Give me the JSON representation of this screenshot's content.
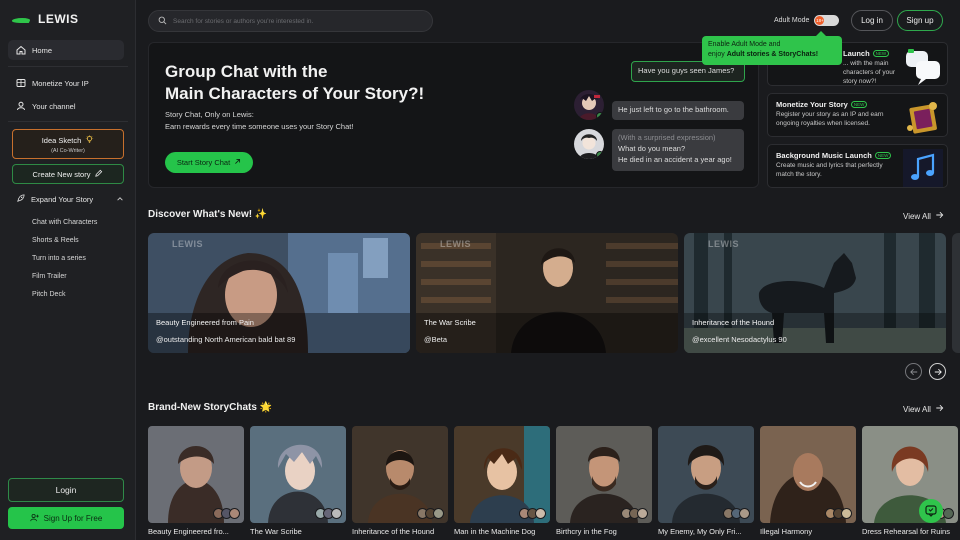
{
  "brand": {
    "name": "LEWIS"
  },
  "sidebar": {
    "items": [
      {
        "label": "Home",
        "icon": "home-icon"
      },
      {
        "label": "Monetize Your IP",
        "icon": "monetize-icon"
      },
      {
        "label": "Your channel",
        "icon": "user-icon"
      }
    ],
    "idea_sketch": {
      "label": "Idea Sketch",
      "sub": "(AI Co-Writer)"
    },
    "create_story": "Create New story",
    "expand": {
      "label": "Expand Your Story",
      "children": [
        "Chat with Characters",
        "Shorts & Reels",
        "Turn into a series",
        "Film Trailer",
        "Pitch Deck"
      ]
    },
    "login": "Login",
    "signup": "Sign Up for Free"
  },
  "topbar": {
    "search_placeholder": "Search for stories or authors you're interested in.",
    "adult_mode": "Adult Mode",
    "adult_badge": "18+",
    "login": "Log in",
    "signup": "Sign up",
    "tooltip": {
      "line1": "Enable Adult Mode and",
      "line2_prefix": "enjoy ",
      "line2_bold": "Adult stories & StoryChats!"
    }
  },
  "hero": {
    "title_line1": "Group Chat with the",
    "title_line2": "Main Characters of Your Story?!",
    "sub1": "Story Chat, Only on Lewis:",
    "sub2": "Earn rewards every time someone uses your Story Chat!",
    "cta": "Start Story Chat",
    "chat": {
      "q": "Have you guys seen James?",
      "a": "He just left to go to the bathroom.",
      "b_em": "(With a surprised expression)",
      "b_1": "What do you mean?",
      "b_2": "He died in an accident a year ago!"
    }
  },
  "promos": [
    {
      "title": "Launch",
      "badge": "NEW",
      "desc": "... with the main characters of your story now?!"
    },
    {
      "title": "Monetize Your Story",
      "badge": "NEW",
      "desc": "Register your story as an IP and earn ongoing royalties when licensed."
    },
    {
      "title": "Background Music Launch",
      "badge": "NEW",
      "desc": "Create music and lyrics that perfectly match the story."
    }
  ],
  "discover": {
    "title": "Discover What's New! ✨",
    "view_all": "View All",
    "watermark": "LEWIS",
    "cards": [
      {
        "title": "Beauty Engineered from Pain",
        "author": "@outstanding North American bald bat 89"
      },
      {
        "title": "The War Scribe",
        "author": "@Beta"
      },
      {
        "title": "Inheritance of the Hound",
        "author": "@excellent Nesodactylus 90"
      }
    ]
  },
  "storychats": {
    "title": "Brand-New StoryChats 🌟",
    "view_all": "View All",
    "cards": [
      {
        "label": "Beauty Engineered fro..."
      },
      {
        "label": "The War Scribe"
      },
      {
        "label": "Inheritance of the Hound"
      },
      {
        "label": "Man in the Machine Dog"
      },
      {
        "label": "Birthcry in the Fog"
      },
      {
        "label": "My Enemy, My Only Fri..."
      },
      {
        "label": "Illegal Harmony"
      },
      {
        "label": "Dress Rehearsal for Ruins"
      }
    ]
  },
  "colors": {
    "accent": "#2fc44b",
    "background": "#1a1b1e",
    "warning": "#c7702d"
  }
}
